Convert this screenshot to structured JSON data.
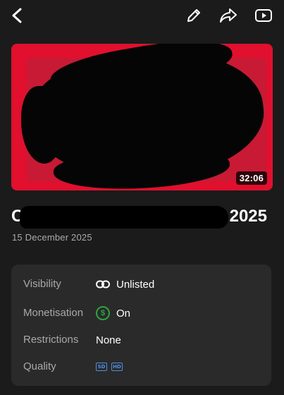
{
  "topbar": {
    "back_icon": "back-chevron-icon",
    "edit_icon": "pencil-icon",
    "share_icon": "share-arrow-icon",
    "studio_icon": "youtube-play-icon"
  },
  "video": {
    "duration": "32:06",
    "title_start": "C",
    "title_end": "2025",
    "date": "15 December 2025"
  },
  "details": {
    "visibility": {
      "label": "Visibility",
      "value": "Unlisted",
      "icon": "link-icon"
    },
    "monetisation": {
      "label": "Monetisation",
      "value": "On",
      "icon": "dollar-circle-icon",
      "icon_color": "#2ba640"
    },
    "restrictions": {
      "label": "Restrictions",
      "value": "None"
    },
    "quality": {
      "label": "Quality",
      "badges": [
        "SD",
        "HD"
      ],
      "badge_color": "#4f8fe6"
    }
  },
  "colors": {
    "background": "#1b1b1b",
    "card": "#2a2a2a",
    "thumbnail_red": "#e0102e"
  }
}
